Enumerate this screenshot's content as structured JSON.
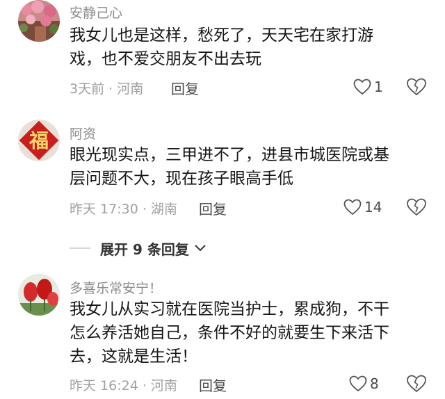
{
  "comments": [
    {
      "username": "安静己心",
      "lines": [
        "我女儿也是这样，愁死了，天天宅在家打游",
        "戏，也不爱交朋友不出去玩"
      ],
      "meta": "3天前 · 河南",
      "reply_label": "回复",
      "likes": "1"
    },
    {
      "username": "阿资",
      "avatar_glyph": "福",
      "lines": [
        "眼光现实点，三甲进不了，进县市城医院或基",
        "层问题不大，现在孩子眼高手低"
      ],
      "meta": "昨天 17:30 · 湖南",
      "reply_label": "回复",
      "likes": "14"
    },
    {
      "username": "多喜乐常安宁！",
      "lines": [
        "我女儿从实习就在医院当护士，累成狗，不干",
        "怎么养活她自己，条件不好的就要生下来活下",
        "去，这就是生活！"
      ],
      "meta": "昨天 16:24 · 河南",
      "reply_label": "回复",
      "likes": "8"
    }
  ],
  "expand": {
    "label": "展开 9 条回复"
  },
  "icons": {
    "like": "heart-outline-icon",
    "dislike": "broken-heart-icon",
    "expand": "chevron-down-icon"
  }
}
